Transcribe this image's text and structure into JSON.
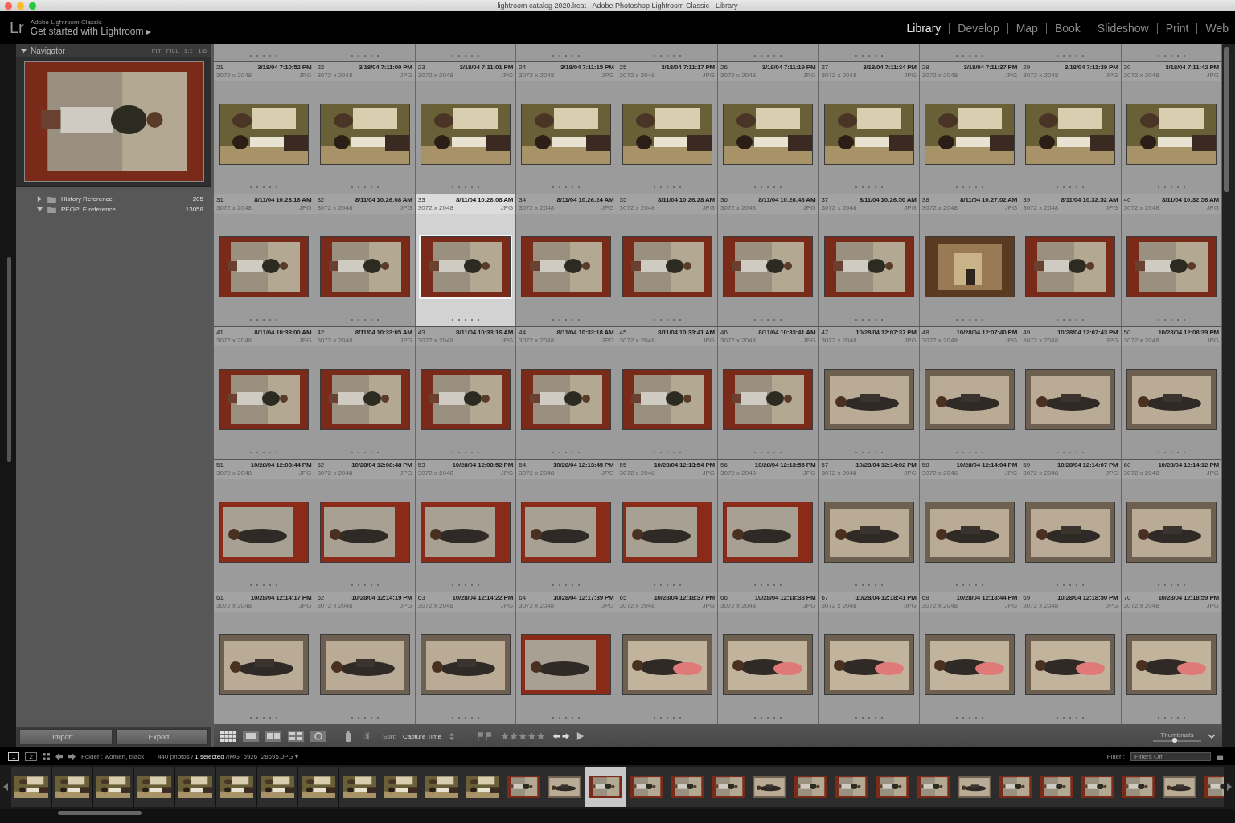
{
  "window": {
    "title": "lightroom catalog 2020.lrcat - Adobe Photoshop Lightroom Classic - Library"
  },
  "identity": {
    "logo": "Lr",
    "app": "Adobe Lightroom Classic",
    "prompt": "Get started with Lightroom",
    "prompt_arrow": "▸"
  },
  "modules": [
    {
      "label": "Library",
      "selected": true
    },
    {
      "label": "Develop",
      "selected": false
    },
    {
      "label": "Map",
      "selected": false
    },
    {
      "label": "Book",
      "selected": false
    },
    {
      "label": "Slideshow",
      "selected": false
    },
    {
      "label": "Print",
      "selected": false
    },
    {
      "label": "Web",
      "selected": false
    }
  ],
  "navigator": {
    "title": "Navigator",
    "zoom_options": [
      {
        "label": "FIT",
        "selected": false
      },
      {
        "label": "FILL",
        "selected": false
      },
      {
        "label": "1:1",
        "selected": false
      },
      {
        "label": "1:8",
        "selected": false
      }
    ]
  },
  "folders": [
    {
      "name": "History Reference",
      "count": "205",
      "expanded": false
    },
    {
      "name": "PEOPLE reference",
      "count": "13058",
      "expanded": true
    }
  ],
  "panel_buttons": [
    "Import...",
    "Export..."
  ],
  "grid": {
    "cells": [
      {
        "index": "21",
        "date": "3/18/04 7:10:52 PM",
        "dimensions": "3072 x 2048",
        "format": "JPG",
        "selected": false
      },
      {
        "index": "22",
        "date": "3/18/04 7:11:00 PM",
        "dimensions": "3072 x 2048",
        "format": "JPG",
        "selected": false
      },
      {
        "index": "23",
        "date": "3/18/04 7:11:01 PM",
        "dimensions": "3072 x 2048",
        "format": "JPG",
        "selected": false
      },
      {
        "index": "24",
        "date": "3/18/04 7:11:15 PM",
        "dimensions": "3072 x 2048",
        "format": "JPG",
        "selected": false
      },
      {
        "index": "25",
        "date": "3/18/04 7:11:17 PM",
        "dimensions": "3072 x 2048",
        "format": "JPG",
        "selected": false
      },
      {
        "index": "26",
        "date": "3/18/04 7:11:19 PM",
        "dimensions": "3072 x 2048",
        "format": "JPG",
        "selected": false
      },
      {
        "index": "27",
        "date": "3/18/04 7:11:34 PM",
        "dimensions": "3072 x 2048",
        "format": "JPG",
        "selected": false
      },
      {
        "index": "28",
        "date": "3/18/04 7:11:37 PM",
        "dimensions": "3072 x 2048",
        "format": "JPG",
        "selected": false
      },
      {
        "index": "29",
        "date": "3/18/04 7:11:39 PM",
        "dimensions": "3072 x 2048",
        "format": "JPG",
        "selected": false
      },
      {
        "index": "30",
        "date": "3/18/04 7:11:42 PM",
        "dimensions": "3072 x 2048",
        "format": "JPG",
        "selected": false
      },
      {
        "index": "31",
        "date": "8/11/04 10:23:16 AM",
        "dimensions": "3072 x 2048",
        "format": "JPG",
        "selected": false
      },
      {
        "index": "32",
        "date": "8/11/04 10:26:08 AM",
        "dimensions": "3072 x 2048",
        "format": "JPG",
        "selected": false
      },
      {
        "index": "33",
        "date": "8/11/04 10:26:08 AM",
        "dimensions": "3072 x 2048",
        "format": "JPG",
        "selected": true
      },
      {
        "index": "34",
        "date": "8/11/04 10:26:24 AM",
        "dimensions": "3072 x 2048",
        "format": "JPG",
        "selected": false
      },
      {
        "index": "35",
        "date": "8/11/04 10:26:28 AM",
        "dimensions": "3072 x 2048",
        "format": "JPG",
        "selected": false
      },
      {
        "index": "36",
        "date": "8/11/04 10:26:48 AM",
        "dimensions": "3072 x 2048",
        "format": "JPG",
        "selected": false
      },
      {
        "index": "37",
        "date": "8/11/04 10:26:50 AM",
        "dimensions": "3072 x 2048",
        "format": "JPG",
        "selected": false
      },
      {
        "index": "38",
        "date": "8/11/04 10:27:02 AM",
        "dimensions": "3072 x 2048",
        "format": "JPG",
        "selected": false
      },
      {
        "index": "39",
        "date": "8/11/04 10:32:52 AM",
        "dimensions": "3072 x 2048",
        "format": "JPG",
        "selected": false
      },
      {
        "index": "40",
        "date": "8/11/04 10:32:56 AM",
        "dimensions": "3072 x 2048",
        "format": "JPG",
        "selected": false
      },
      {
        "index": "41",
        "date": "8/11/04 10:33:00 AM",
        "dimensions": "3072 x 2048",
        "format": "JPG",
        "selected": false
      },
      {
        "index": "42",
        "date": "8/11/04 10:33:05 AM",
        "dimensions": "3072 x 2048",
        "format": "JPG",
        "selected": false
      },
      {
        "index": "43",
        "date": "8/11/04 10:33:16 AM",
        "dimensions": "3072 x 2048",
        "format": "JPG",
        "selected": false
      },
      {
        "index": "44",
        "date": "8/11/04 10:33:18 AM",
        "dimensions": "3072 x 2048",
        "format": "JPG",
        "selected": false
      },
      {
        "index": "45",
        "date": "8/11/04 10:33:41 AM",
        "dimensions": "3072 x 2048",
        "format": "JPG",
        "selected": false
      },
      {
        "index": "46",
        "date": "8/11/04 10:33:41 AM",
        "dimensions": "3072 x 2048",
        "format": "JPG",
        "selected": false
      },
      {
        "index": "47",
        "date": "10/28/04 12:07:37 PM",
        "dimensions": "3072 x 2048",
        "format": "JPG",
        "selected": false
      },
      {
        "index": "48",
        "date": "10/28/04 12:07:40 PM",
        "dimensions": "3072 x 2048",
        "format": "JPG",
        "selected": false
      },
      {
        "index": "49",
        "date": "10/28/04 12:07:43 PM",
        "dimensions": "3072 x 2048",
        "format": "JPG",
        "selected": false
      },
      {
        "index": "50",
        "date": "10/28/04 12:08:39 PM",
        "dimensions": "3072 x 2048",
        "format": "JPG",
        "selected": false
      },
      {
        "index": "51",
        "date": "10/28/04 12:08:44 PM",
        "dimensions": "3072 x 2048",
        "format": "JPG",
        "selected": false
      },
      {
        "index": "52",
        "date": "10/28/04 12:08:48 PM",
        "dimensions": "3072 x 2048",
        "format": "JPG",
        "selected": false
      },
      {
        "index": "53",
        "date": "10/28/04 12:08:52 PM",
        "dimensions": "3072 x 2048",
        "format": "JPG",
        "selected": false
      },
      {
        "index": "54",
        "date": "10/28/04 12:13:45 PM",
        "dimensions": "3072 x 2048",
        "format": "JPG",
        "selected": false
      },
      {
        "index": "55",
        "date": "10/28/04 12:13:54 PM",
        "dimensions": "3072 x 2048",
        "format": "JPG",
        "selected": false
      },
      {
        "index": "56",
        "date": "10/28/04 12:13:55 PM",
        "dimensions": "3072 x 2048",
        "format": "JPG",
        "selected": false
      },
      {
        "index": "57",
        "date": "10/28/04 12:14:02 PM",
        "dimensions": "3072 x 2048",
        "format": "JPG",
        "selected": false
      },
      {
        "index": "58",
        "date": "10/28/04 12:14:04 PM",
        "dimensions": "3072 x 2048",
        "format": "JPG",
        "selected": false
      },
      {
        "index": "59",
        "date": "10/28/04 12:14:07 PM",
        "dimensions": "3072 x 2048",
        "format": "JPG",
        "selected": false
      },
      {
        "index": "60",
        "date": "10/28/04 12:14:12 PM",
        "dimensions": "3072 x 2048",
        "format": "JPG",
        "selected": false
      },
      {
        "index": "61",
        "date": "10/28/04 12:14:17 PM",
        "dimensions": "3072 x 2048",
        "format": "JPG",
        "selected": false
      },
      {
        "index": "62",
        "date": "10/28/04 12:14:19 PM",
        "dimensions": "3072 x 2048",
        "format": "JPG",
        "selected": false
      },
      {
        "index": "63",
        "date": "10/28/04 12:14:22 PM",
        "dimensions": "3072 x 2048",
        "format": "JPG",
        "selected": false
      },
      {
        "index": "64",
        "date": "10/28/04 12:17:39 PM",
        "dimensions": "3072 x 2048",
        "format": "JPG",
        "selected": false
      },
      {
        "index": "65",
        "date": "10/28/04 12:18:37 PM",
        "dimensions": "3072 x 2048",
        "format": "JPG",
        "selected": false
      },
      {
        "index": "66",
        "date": "10/28/04 12:18:38 PM",
        "dimensions": "3072 x 2048",
        "format": "JPG",
        "selected": false
      },
      {
        "index": "67",
        "date": "10/28/04 12:18:41 PM",
        "dimensions": "3072 x 2048",
        "format": "JPG",
        "selected": false
      },
      {
        "index": "68",
        "date": "10/28/04 12:18:44 PM",
        "dimensions": "3072 x 2048",
        "format": "JPG",
        "selected": false
      },
      {
        "index": "69",
        "date": "10/28/04 12:18:50 PM",
        "dimensions": "3072 x 2048",
        "format": "JPG",
        "selected": false
      },
      {
        "index": "70",
        "date": "10/28/04 12:18:59 PM",
        "dimensions": "3072 x 2048",
        "format": "JPG",
        "selected": false
      }
    ]
  },
  "toolbar": {
    "sort_label": "Sort:",
    "sort_value": "Capture Time",
    "thumbnails": {
      "label": "Thumbnails",
      "level": 0.45
    }
  },
  "filmstrip": {
    "pages": [
      {
        "label": "1",
        "selected": true
      },
      {
        "label": "2",
        "selected": false
      }
    ],
    "source": "Folder : women, black",
    "count": "440 photos /",
    "selection": "1 selected",
    "file": "/IMG_5926_28695.JPG ▾",
    "filter_label": "Filter :",
    "filter_value": "Filters Off",
    "thumbs": [
      {
        "selected": false
      },
      {
        "selected": false
      },
      {
        "selected": false
      },
      {
        "selected": false
      },
      {
        "selected": false
      },
      {
        "selected": false
      },
      {
        "selected": false
      },
      {
        "selected": false
      },
      {
        "selected": false
      },
      {
        "selected": false
      },
      {
        "selected": false
      },
      {
        "selected": false
      },
      {
        "selected": false
      },
      {
        "selected": false
      },
      {
        "selected": true
      },
      {
        "selected": false
      },
      {
        "selected": false
      },
      {
        "selected": false
      },
      {
        "selected": false
      },
      {
        "selected": false
      },
      {
        "selected": false
      },
      {
        "selected": false
      },
      {
        "selected": false
      },
      {
        "selected": false
      },
      {
        "selected": false
      },
      {
        "selected": false
      },
      {
        "selected": false
      },
      {
        "selected": false
      },
      {
        "selected": false
      },
      {
        "selected": false
      }
    ]
  }
}
